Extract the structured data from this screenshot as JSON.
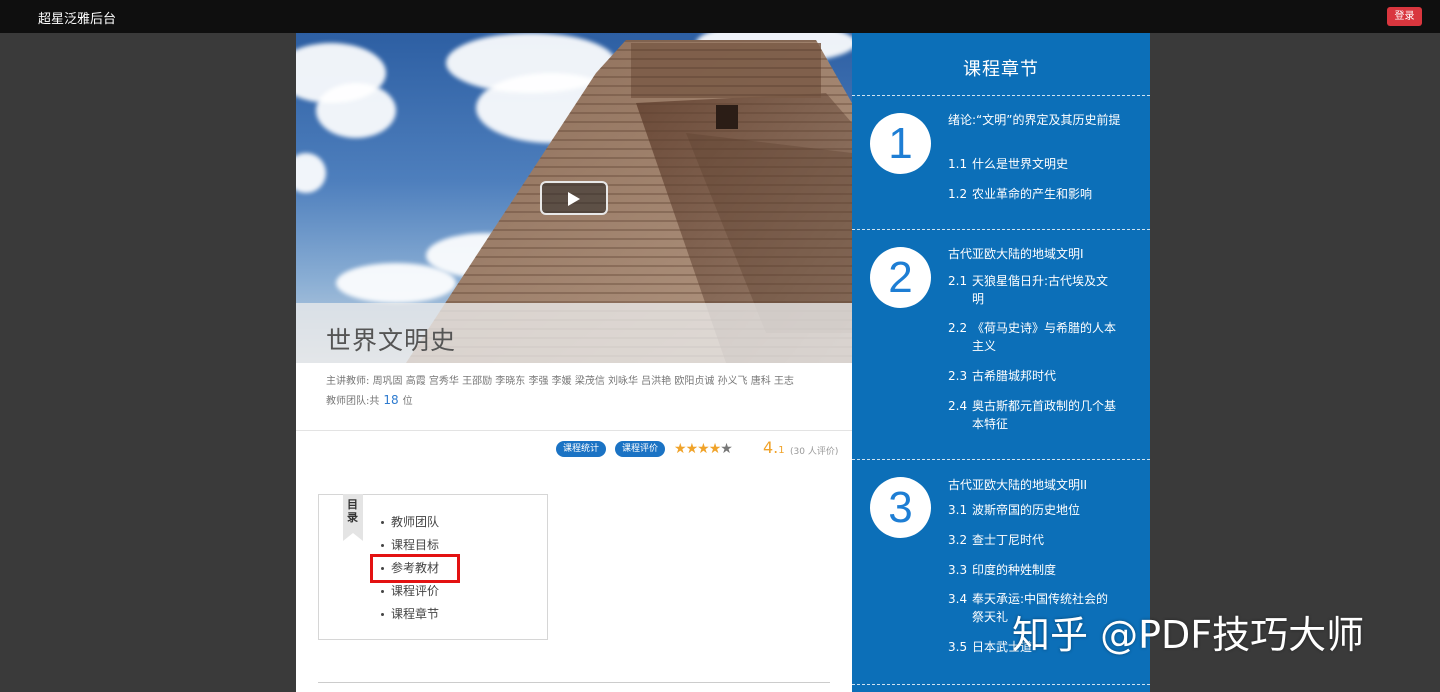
{
  "topbar": {
    "brand": "超星泛雅后台",
    "login_label": "登录"
  },
  "course": {
    "title": "世界文明史",
    "teachers_label": "主讲教师:",
    "teachers": "周巩固 高霞 宫秀华 王邵励 李晓东 李强 李媛 梁茂信 刘咏华 吕洪艳 欧阳贞诚 孙义飞 唐科 王志",
    "team_label": "教师团队:共",
    "team_count": "18",
    "team_unit": "位"
  },
  "actions": {
    "stats_label": "课程统计",
    "review_label": "课程评价",
    "rating_main": "4.",
    "rating_decimal": "1",
    "reviews": "(30 人评价)"
  },
  "rating": {
    "value": 4.1,
    "max": 5
  },
  "toc": {
    "flag": "目录",
    "items": [
      "教师团队",
      "课程目标",
      "参考教材",
      "课程评价",
      "课程章节"
    ],
    "highlighted_index": 2
  },
  "chapters": {
    "heading": "课程章节",
    "list": [
      {
        "num": "1",
        "title": "绪论:“文明”的界定及其历史前提",
        "sections": [
          {
            "n": "1.1",
            "t": "什么是世界文明史"
          },
          {
            "n": "1.2",
            "t": "农业革命的产生和影响"
          }
        ]
      },
      {
        "num": "2",
        "title": "古代亚欧大陆的地域文明I",
        "sections": [
          {
            "n": "2.1",
            "t": "天狼星偕日升:古代埃及文明"
          },
          {
            "n": "2.2",
            "t": "《荷马史诗》与希腊的人本主义"
          },
          {
            "n": "2.3",
            "t": "古希腊城邦时代"
          },
          {
            "n": "2.4",
            "t": "奥古斯都元首政制的几个基本特征"
          }
        ]
      },
      {
        "num": "3",
        "title": "古代亚欧大陆的地域文明II",
        "sections": [
          {
            "n": "3.1",
            "t": "波斯帝国的历史地位"
          },
          {
            "n": "3.2",
            "t": "查士丁尼时代"
          },
          {
            "n": "3.3",
            "t": "印度的种姓制度"
          },
          {
            "n": "3.4",
            "t": "奉天承运:中国传统社会的祭天礼"
          },
          {
            "n": "3.5",
            "t": "日本武士道"
          }
        ]
      }
    ]
  },
  "watermark": "知乎 @PDF技巧大师",
  "colors": {
    "topbar": "#0f0f0f",
    "panel_blue": "#0c6fb8",
    "login_red": "#d9363e",
    "highlight_red": "#e31212",
    "star": "#f0a32a",
    "pill": "#1b73c4"
  }
}
